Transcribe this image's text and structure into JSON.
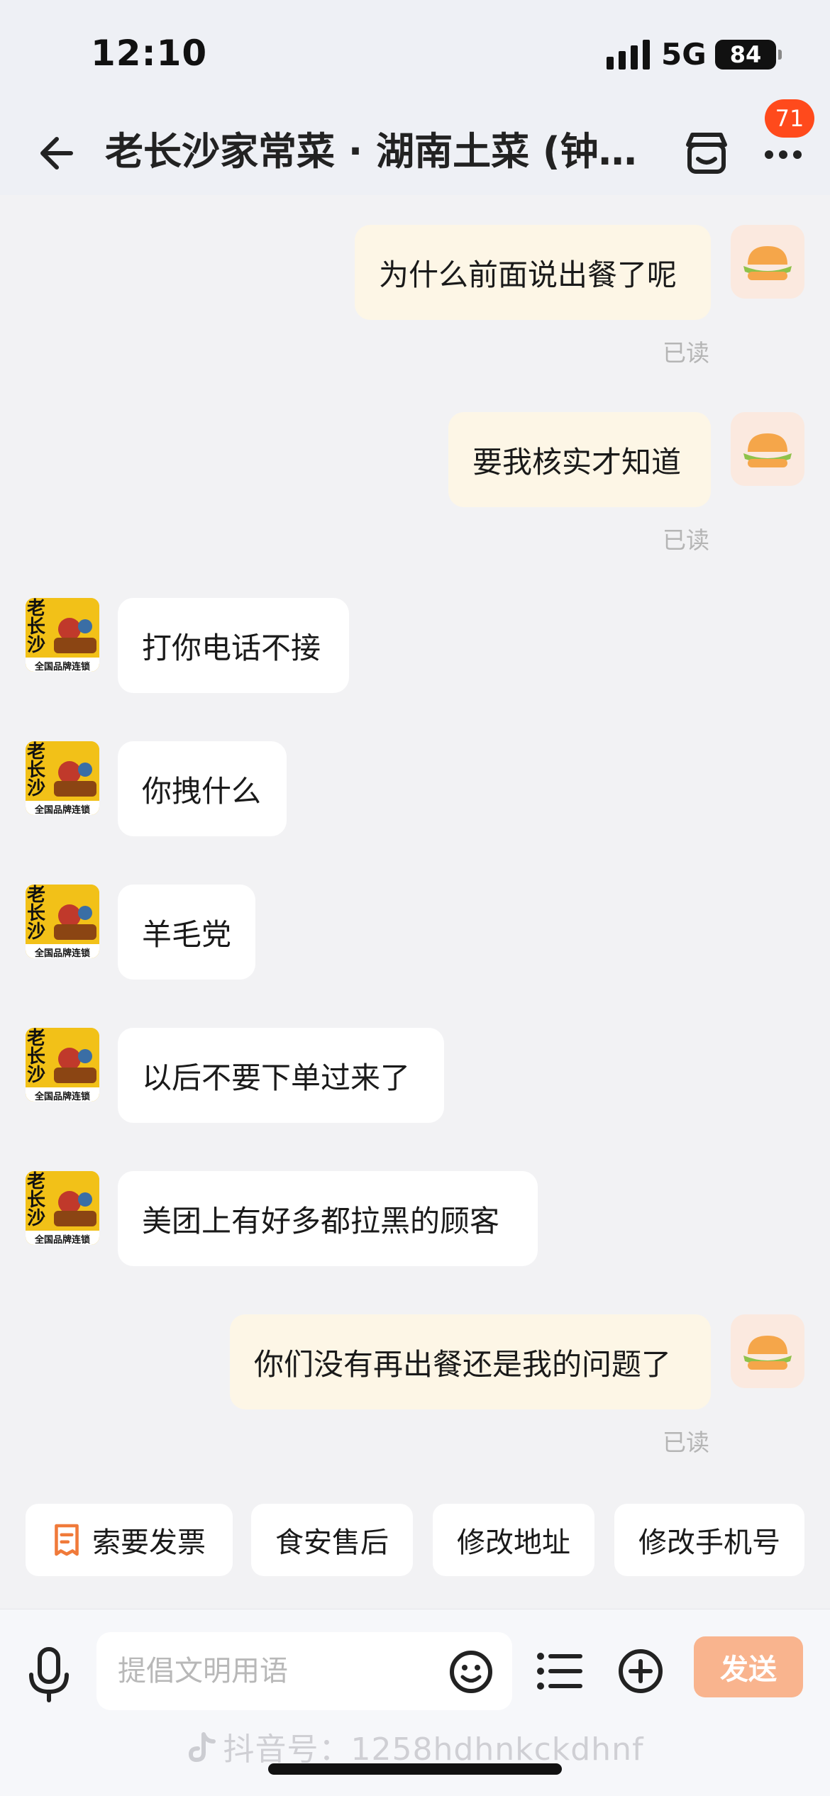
{
  "status_bar": {
    "time": "12:10",
    "network": "5G",
    "battery": "84"
  },
  "nav": {
    "title": "老长沙家常菜 · 湖南土菜 (钟…",
    "unread_count": "71"
  },
  "messages": [
    {
      "side": "out",
      "text": "为什么前面说出餐了呢",
      "status": "已读"
    },
    {
      "side": "out",
      "text": "要我核实才知道",
      "status": "已读"
    },
    {
      "side": "in",
      "text": "打你电话不接"
    },
    {
      "side": "in",
      "text": "你拽什么"
    },
    {
      "side": "in",
      "text": "羊毛党"
    },
    {
      "side": "in",
      "text": "以后不要下单过来了"
    },
    {
      "side": "in",
      "text": "美团上有好多都拉黑的顾客"
    },
    {
      "side": "out",
      "text": "你们没有再出餐还是我的问题了",
      "status": "已读"
    }
  ],
  "shop_avatar_text": {
    "logo": "老长沙",
    "slogan": "全国品牌连锁"
  },
  "quick_actions": [
    "索要发票",
    "食安售后",
    "修改地址",
    "修改手机号"
  ],
  "composer": {
    "placeholder": "提倡文明用语",
    "send_label": "发送"
  },
  "watermark": "抖音号：1258hdhnkckdhnf",
  "colors": {
    "outgoing_bubble": "#fdf6e6",
    "incoming_bubble": "#ffffff",
    "badge": "#ff4a1c",
    "send_button": "#f9b48e",
    "invoice_icon": "#f07a3a"
  }
}
